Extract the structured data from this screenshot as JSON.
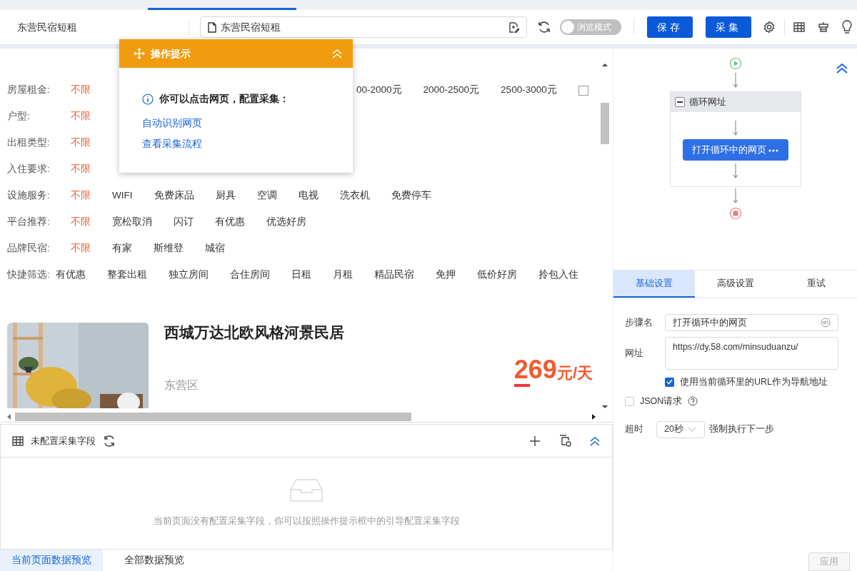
{
  "toolbar": {
    "task_name": "东营民宿短租",
    "url_field": {
      "value": "东营民宿短租"
    },
    "browse_mode": {
      "label": "浏览模式",
      "on": false
    },
    "buttons": [
      "保存",
      "采集"
    ]
  },
  "tip": {
    "title": "操作提示",
    "message": "你可以点击网页，配置采集：",
    "links": [
      "自动识别网页",
      "查看采集流程"
    ]
  },
  "filters": [
    {
      "label": "房屋租金:",
      "options": [
        {
          "text": "不限",
          "selected": true
        },
        {
          "text": "00-2000元",
          "selected": false
        },
        {
          "text": "2000-2500元",
          "selected": false
        },
        {
          "text": "2500-3000元",
          "selected": false
        }
      ],
      "checkbox": {
        "checked": false
      }
    },
    {
      "label": "户型:",
      "options": [
        {
          "text": "不限",
          "selected": true
        }
      ]
    },
    {
      "label": "出租类型:",
      "options": [
        {
          "text": "不限",
          "selected": true
        }
      ]
    },
    {
      "label": "入住要求:",
      "options": [
        {
          "text": "不限",
          "selected": true
        }
      ]
    },
    {
      "label": "设施服务:",
      "options": [
        {
          "text": "不限",
          "selected": true
        },
        {
          "text": "WIFI",
          "selected": false
        },
        {
          "text": "免费床品",
          "selected": false
        },
        {
          "text": "厨具",
          "selected": false
        },
        {
          "text": "空调",
          "selected": false
        },
        {
          "text": "电视",
          "selected": false
        },
        {
          "text": "洗衣机",
          "selected": false
        },
        {
          "text": "免费停车",
          "selected": false
        }
      ]
    },
    {
      "label": "平台推荐:",
      "options": [
        {
          "text": "不限",
          "selected": true
        },
        {
          "text": "宽松取消",
          "selected": false
        },
        {
          "text": "闪订",
          "selected": false
        },
        {
          "text": "有优惠",
          "selected": false
        },
        {
          "text": "优选好房",
          "selected": false
        }
      ]
    },
    {
      "label": "品牌民宿:",
      "options": [
        {
          "text": "不限",
          "selected": true
        },
        {
          "text": "有家",
          "selected": false
        },
        {
          "text": "斯维登",
          "selected": false
        },
        {
          "text": "城宿",
          "selected": false
        }
      ]
    },
    {
      "label": "快捷筛选:",
      "options": [
        {
          "text": "有优惠",
          "selected": false
        },
        {
          "text": "整套出租",
          "selected": false
        },
        {
          "text": "独立房间",
          "selected": false
        },
        {
          "text": "合住房间",
          "selected": false
        },
        {
          "text": "日租",
          "selected": false
        },
        {
          "text": "月租",
          "selected": false
        },
        {
          "text": "精品民宿",
          "selected": false
        },
        {
          "text": "免押",
          "selected": false
        },
        {
          "text": "低价好房",
          "selected": false
        },
        {
          "text": "拎包入住",
          "selected": false
        }
      ]
    }
  ],
  "listing": {
    "title": "西城万达北欧风格河景民居",
    "district": "东营区",
    "price": "269",
    "unit": "元/天"
  },
  "flow": {
    "loop": {
      "title": "循环网址",
      "expanded": true,
      "step": "打开循环中的网页"
    }
  },
  "settings": {
    "tabs": [
      {
        "label": "基础设置",
        "selected": true
      },
      {
        "label": "高级设置",
        "selected": false
      },
      {
        "label": "重试",
        "selected": false
      }
    ],
    "step_name": {
      "label": "步骤名",
      "value": "打开循环中的网页"
    },
    "url": {
      "label": "网址",
      "value": "https://dy.58.com/minsuduanzu/"
    },
    "use_loop_url": {
      "label": "使用当前循环里的URL作为导航地址",
      "checked": true
    },
    "json_request": {
      "label": "JSON请求",
      "checked": false
    },
    "timeout": {
      "label": "超时",
      "value": "20秒",
      "after": "强制执行下一步"
    }
  },
  "fields_panel": {
    "title": "未配置采集字段",
    "empty_message": "当前页面没有配置采集字段，你可以按照操作提示框中的引导配置采集字段"
  },
  "preview_tabs": [
    {
      "label": "当前页面数据预览",
      "selected": true
    },
    {
      "label": "全部数据预览",
      "selected": false
    }
  ],
  "apply_button": {
    "label": "应用",
    "disabled": true
  }
}
